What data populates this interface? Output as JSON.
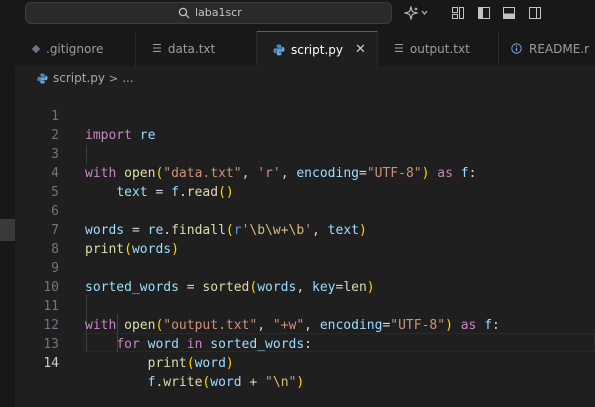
{
  "titlebar": {
    "search_text": "laba1scr"
  },
  "tabs": [
    {
      "label": ".gitignore",
      "icon": "gitignore-file-icon",
      "active": false
    },
    {
      "label": "data.txt",
      "icon": "text-file-icon",
      "active": false
    },
    {
      "label": "script.py",
      "icon": "python-file-icon",
      "active": true,
      "close": "✕"
    },
    {
      "label": "output.txt",
      "icon": "text-file-icon",
      "active": false
    },
    {
      "label": "README.r",
      "icon": "info-icon",
      "active": false
    }
  ],
  "breadcrumb": {
    "file": "script.py",
    "separator": ">",
    "ellipsis": "..."
  },
  "editor": {
    "current_line": 14,
    "line_numbers": [
      "1",
      "2",
      "3",
      "4",
      "5",
      "6",
      "7",
      "8",
      "9",
      "10",
      "11",
      "12",
      "13",
      "14"
    ],
    "lines": [
      "import re",
      "",
      "with open(\"data.txt\", 'r', encoding=\"UTF-8\") as f:",
      "    text = f.read()",
      "",
      "words = re.findall(r'\\b\\w+\\b', text)",
      "print(words)",
      "",
      "sorted_words = sorted(words, key=len)",
      "",
      "with open(\"output.txt\", \"+w\", encoding=\"UTF-8\") as f:",
      "    for word in sorted_words:",
      "        print(word)",
      "        f.write(word + \"\\n\")"
    ]
  },
  "colors": {
    "keyword": "#c586c0",
    "function": "#dcdcaa",
    "variable": "#9cdcfe",
    "string": "#ce9178",
    "accent": "#0078d4"
  }
}
